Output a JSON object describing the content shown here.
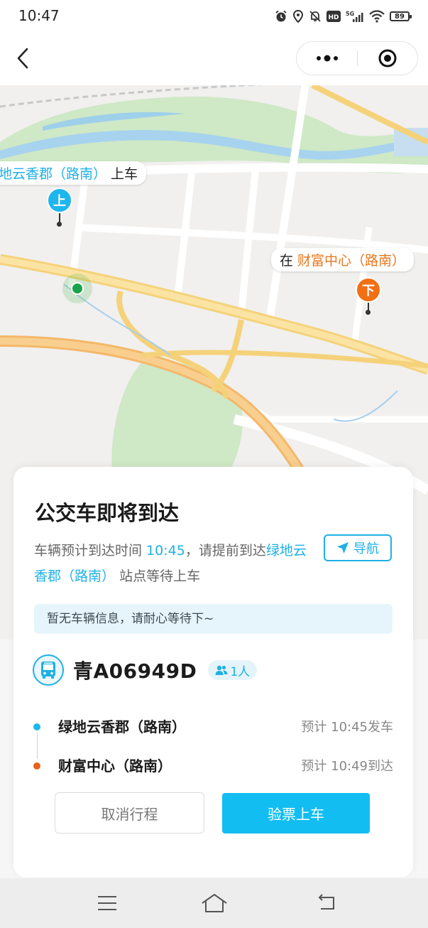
{
  "status_bar": {
    "time": "10:47",
    "network": "5G",
    "battery": "89",
    "icons": [
      "alarm-icon",
      "location-icon",
      "mute-icon",
      "hd-icon",
      "signal-icon",
      "wifi-icon",
      "battery-icon"
    ]
  },
  "nav": {
    "back_icon": "chevron-left-icon",
    "more_icon": "more-dots-icon",
    "close_icon": "target-close-icon"
  },
  "map": {
    "board_label": {
      "stop": "地云香郡（路南）",
      "suffix": " 上车"
    },
    "alight_label": {
      "prefix": "在 ",
      "stop": "财富中心（路南）"
    },
    "board_pin": "上",
    "alight_pin": "下",
    "colors": {
      "board": "#1fb6ee",
      "alight": "#f26f12",
      "location": "#1aa34a"
    }
  },
  "card": {
    "title": "公交车即将到达",
    "arrival_prefix": "车辆预计到达时间 ",
    "arrival_time": "10:45",
    "arrival_mid": "，请提前到达",
    "arrival_stop": "绿地云香郡（路南）",
    "arrival_suffix": "站点等待上车",
    "navigate_label": "导航",
    "notice": "暂无车辆信息，请耐心等待下~",
    "plate": "青A06949D",
    "passengers": "1人",
    "stops": [
      {
        "name": "绿地云香郡（路南）",
        "eta": "预计 10:45发车",
        "color": "#1fb6ee"
      },
      {
        "name": "财富中心（路南）",
        "eta": "预计 10:49到达",
        "color": "#e8611a"
      }
    ],
    "cancel_label": "取消行程",
    "board_label": "验票上车",
    "accent": "#12bdf2"
  },
  "system_nav": {
    "icons": [
      "menu-icon",
      "home-icon",
      "back-icon"
    ]
  }
}
